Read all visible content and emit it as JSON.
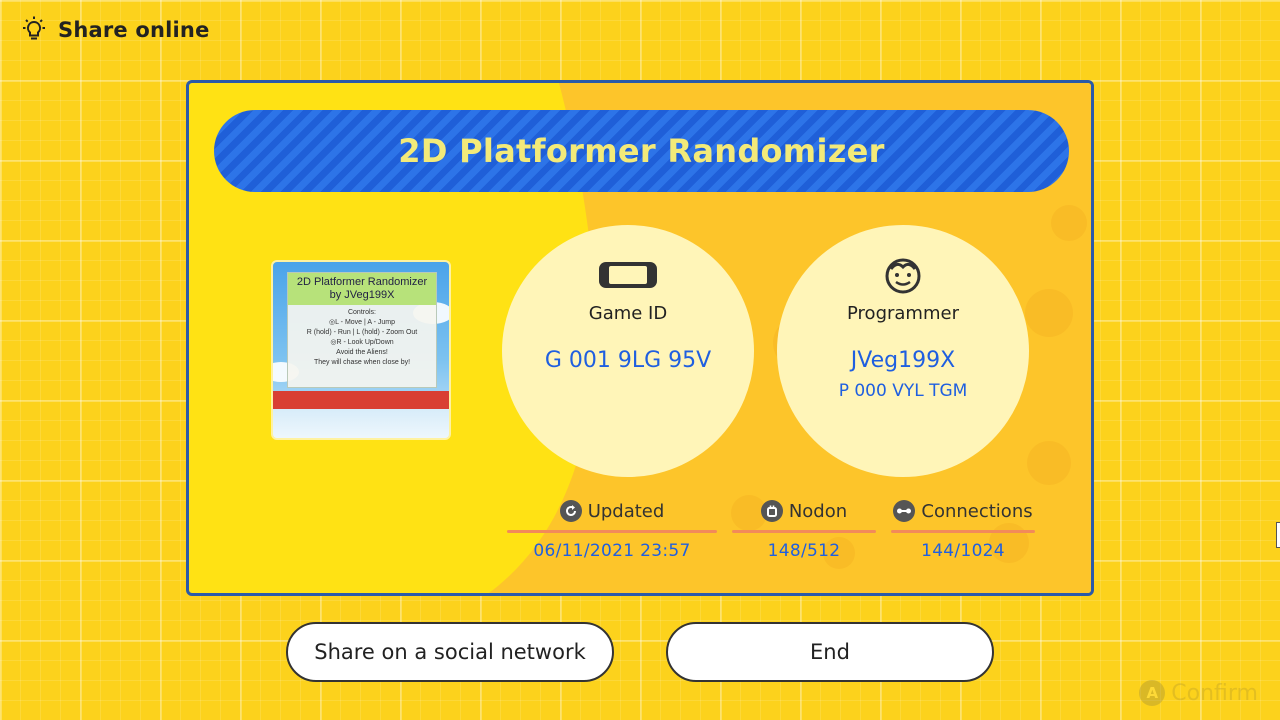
{
  "header": {
    "title": "Share online",
    "icon": "lightbulb-icon"
  },
  "game": {
    "title": "2D Platformer Randomizer",
    "thumbnail": {
      "sign_title": "2D Platformer Randomizer by JVeg199X",
      "sign_lines": [
        "Controls:",
        "◎L - Move | A - Jump",
        "R (hold) - Run | L (hold) - Zoom Out",
        "◎R - Look Up/Down",
        "Avoid the Aliens!",
        "They will chase when close by!"
      ]
    }
  },
  "game_id": {
    "icon": "switch-console-icon",
    "label": "Game ID",
    "value": "G 001 9LG 95V"
  },
  "programmer": {
    "icon": "face-icon",
    "label": "Programmer",
    "name": "JVeg199X",
    "id": "P 000 VYL TGM"
  },
  "stats": {
    "updated": {
      "icon": "refresh-icon",
      "label": "Updated",
      "value": "06/11/2021 23:57"
    },
    "nodon": {
      "icon": "nodon-icon",
      "label": "Nodon",
      "value": "148/512"
    },
    "connections": {
      "icon": "connection-icon",
      "label": "Connections",
      "value": "144/1024"
    }
  },
  "buttons": {
    "share": "Share on a social network",
    "end": "End"
  },
  "footer": {
    "confirm_button": "A",
    "confirm_label": "Confirm"
  },
  "colors": {
    "background": "#fcd21c",
    "card": "#ffe214",
    "card_border": "#2a5aa8",
    "banner": "#2d74e8",
    "banner_text": "#f3ea79",
    "value_text": "#1f5fe0",
    "stat_line": "#f28a5a"
  }
}
